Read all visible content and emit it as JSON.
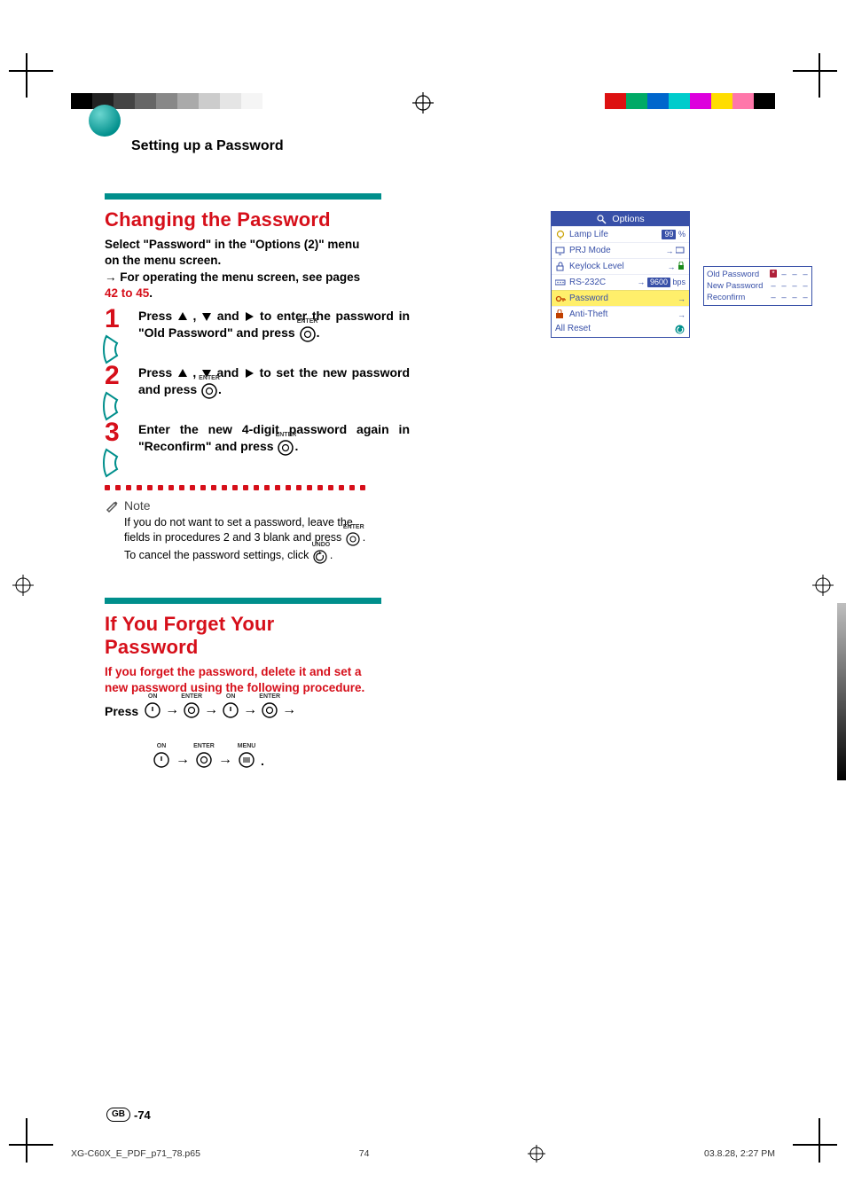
{
  "header": {
    "title": "Setting up a Password"
  },
  "section1": {
    "heading": "Changing the Password",
    "intro_l1": "Select \"Password\" in the \"Options (2)\" menu on the menu screen.",
    "intro_l2_pre": "For operating the menu screen, see pages ",
    "intro_l2_link": "42 to 45",
    "intro_l2_post": "."
  },
  "steps": {
    "s1": {
      "num": "1",
      "body_a": "Press ",
      "body_b": ", ",
      "body_c": " and ",
      "body_d": " to enter the password in \"Old Password\" and press ",
      "body_e": "."
    },
    "s2": {
      "num": "2",
      "body_a": "Press ",
      "body_b": ", ",
      "body_c": " and ",
      "body_d": " to set the new password and press ",
      "body_e": "."
    },
    "s3": {
      "num": "3",
      "body": "Enter the new 4-digit password again in \"Reconfirm\" and press ",
      "body_e": "."
    }
  },
  "note": {
    "label": "Note",
    "l1": "If you do not want to set a password, leave the fields in procedures 2 and 3 blank and press ",
    "l2": "To cancel the password settings, click ",
    "tail": "."
  },
  "section2": {
    "heading": "If You Forget Your Password",
    "intro": "If you forget the password, delete it and set a new password using the following procedure.",
    "press": "Press"
  },
  "osd": {
    "title": "Options",
    "rows": {
      "lamp": {
        "label": "Lamp Life",
        "value": "99",
        "unit": "%"
      },
      "prj": {
        "label": "PRJ Mode"
      },
      "key": {
        "label": "Keylock Level"
      },
      "rs": {
        "label": "RS-232C",
        "value": "9600",
        "unit": "bps"
      },
      "pw": {
        "label": "Password"
      },
      "anti": {
        "label": "Anti-Theft"
      },
      "reset": {
        "label": "All Reset"
      }
    }
  },
  "pwbox": {
    "old": "Old Password",
    "new": "New Password",
    "rec": "Reconfirm"
  },
  "buttons": {
    "enter": "ENTER",
    "on": "ON",
    "menu": "MENU",
    "undo": "UNDO"
  },
  "footer": {
    "gb": "GB",
    "page": "-74",
    "file": "XG-C60X_E_PDF_p71_78.p65",
    "pnum": "74",
    "time": "03.8.28, 2:27 PM"
  }
}
